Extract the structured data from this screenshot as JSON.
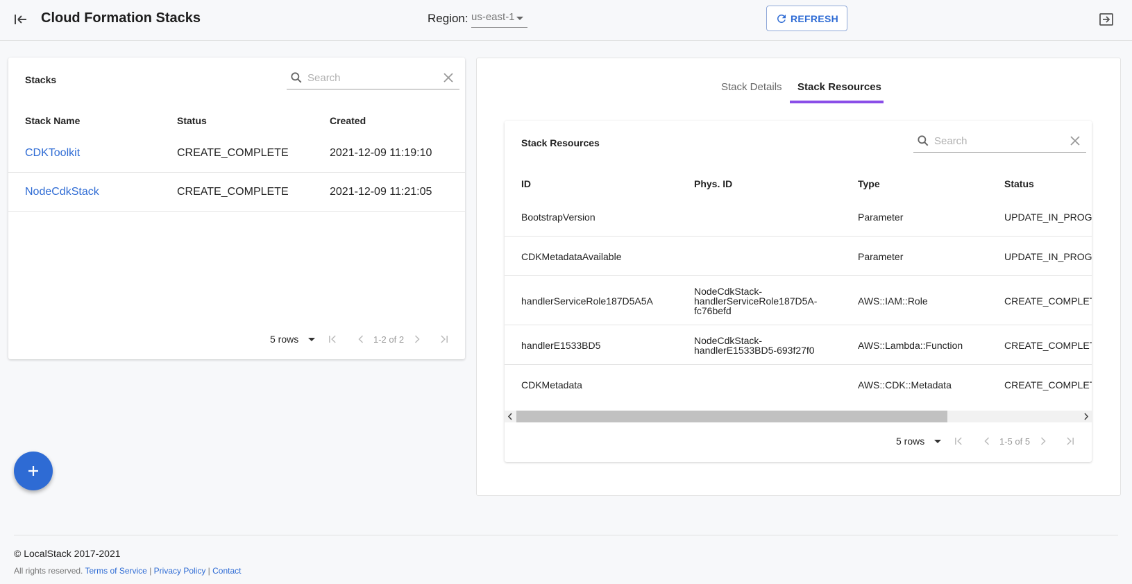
{
  "header": {
    "title": "Cloud Formation Stacks",
    "region_label": "Region:",
    "region_value": "us-east-1",
    "refresh_label": "REFRESH"
  },
  "stacks": {
    "title": "Stacks",
    "search_placeholder": "Search",
    "columns": [
      "Stack Name",
      "Status",
      "Created"
    ],
    "rows": [
      {
        "name": "CDKToolkit",
        "status": "CREATE_COMPLETE",
        "created": "2021-12-09 11:19:10"
      },
      {
        "name": "NodeCdkStack",
        "status": "CREATE_COMPLETE",
        "created": "2021-12-09 11:21:05"
      }
    ],
    "pager": {
      "rows_per_page": "5 rows",
      "range": "1-2 of 2"
    }
  },
  "details": {
    "tabs": [
      {
        "label": "Stack Details",
        "active": false
      },
      {
        "label": "Stack Resources",
        "active": true
      }
    ],
    "resources": {
      "title": "Stack Resources",
      "search_placeholder": "Search",
      "columns": [
        "ID",
        "Phys. ID",
        "Type",
        "Status"
      ],
      "rows": [
        {
          "id": "BootstrapVersion",
          "phys_id": "",
          "type": "Parameter",
          "status": "UPDATE_IN_PROGRESS"
        },
        {
          "id": "CDKMetadataAvailable",
          "phys_id": "",
          "type": "Parameter",
          "status": "UPDATE_IN_PROGRESS"
        },
        {
          "id": "handlerServiceRole187D5A5A",
          "phys_id": "NodeCdkStack-handlerServiceRole187D5A-fc76befd",
          "type": "AWS::IAM::Role",
          "status": "CREATE_COMPLETE"
        },
        {
          "id": "handlerE1533BD5",
          "phys_id": "NodeCdkStack-handlerE1533BD5-693f27f0",
          "type": "AWS::Lambda::Function",
          "status": "CREATE_COMPLETE"
        },
        {
          "id": "CDKMetadata",
          "phys_id": "",
          "type": "AWS::CDK::Metadata",
          "status": "CREATE_COMPLETE"
        }
      ],
      "pager": {
        "rows_per_page": "5 rows",
        "range": "1-5 of 5"
      }
    }
  },
  "fab": {
    "icon": "plus-icon"
  },
  "footer": {
    "copyright": "© LocalStack 2017-2021",
    "rights": "All rights reserved.",
    "links": [
      "Terms of Service",
      "Privacy Policy",
      "Contact"
    ]
  },
  "colors": {
    "accent": "#2e6bd4",
    "tab_indicator": "#8a4ee8"
  }
}
